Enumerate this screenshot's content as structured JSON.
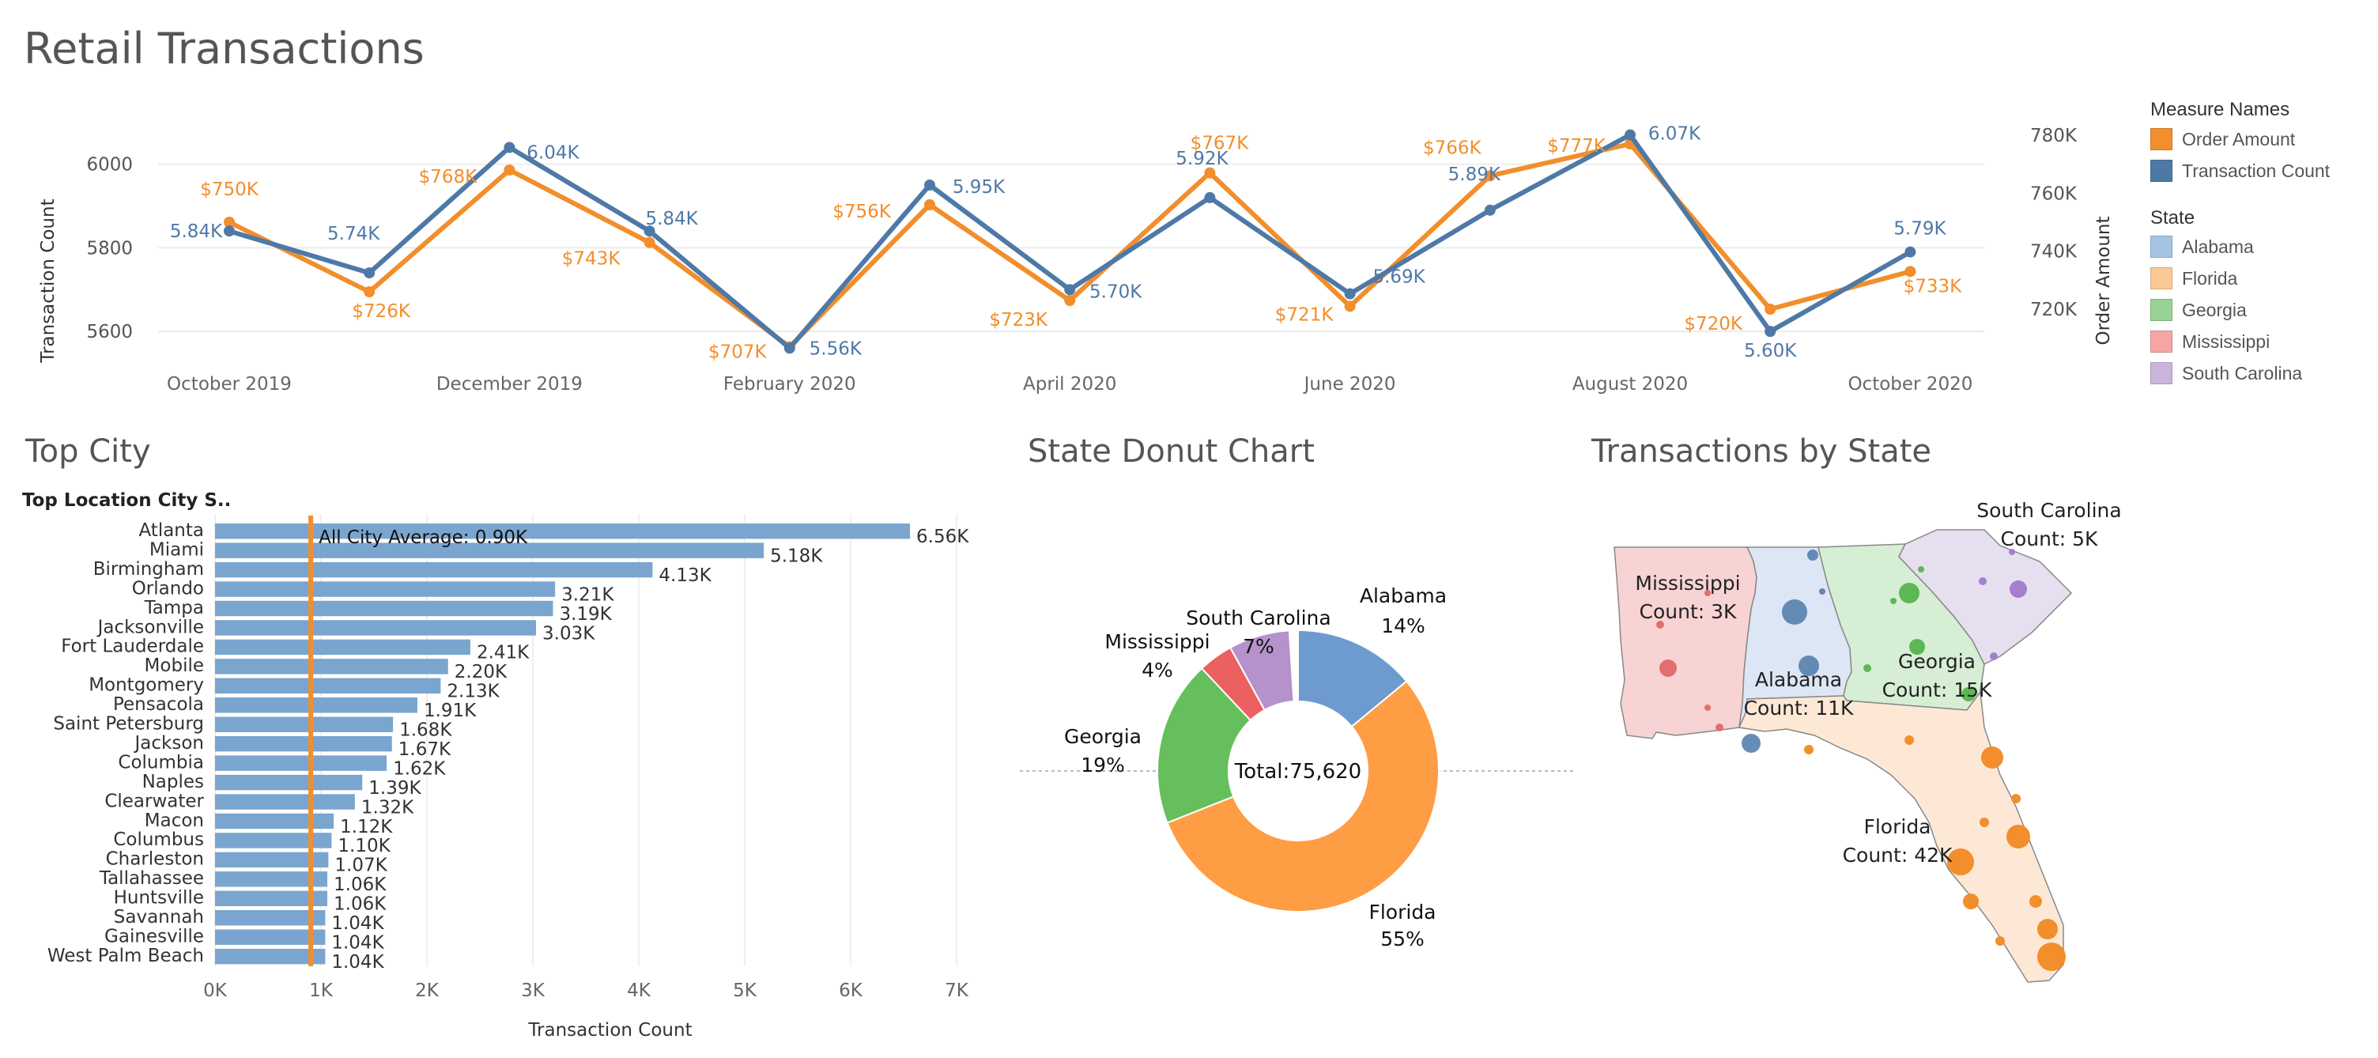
{
  "dashboard": {
    "title": "Retail Transactions",
    "sections": {
      "top_city": "Top City",
      "donut": "State Donut Chart",
      "map": "Transactions by State"
    }
  },
  "colors": {
    "orange": "#F28E2B",
    "blue": "#4E79A7",
    "bar": "#7AA5CF",
    "alabama": "#A5C3E3",
    "florida": "#FBC995",
    "georgia": "#98D294",
    "mississippi": "#F4A6A6",
    "south_carolina": "#C9B5DC"
  },
  "legend": {
    "measure_title": "Measure Names",
    "measures": [
      {
        "label": "Order Amount",
        "color": "#F28E2B"
      },
      {
        "label": "Transaction Count",
        "color": "#4E79A7"
      }
    ],
    "state_title": "State",
    "states": [
      {
        "label": "Alabama",
        "color": "#A5C3E3"
      },
      {
        "label": "Florida",
        "color": "#FBC995"
      },
      {
        "label": "Georgia",
        "color": "#98D294"
      },
      {
        "label": "Mississippi",
        "color": "#F4A6A6"
      },
      {
        "label": "South Carolina",
        "color": "#C9B5DC"
      }
    ]
  },
  "chart_data": [
    {
      "type": "line",
      "title": "",
      "x_months": [
        "Oct 2019",
        "Nov 2019",
        "Dec 2019",
        "Jan 2020",
        "Feb 2020",
        "Mar 2020",
        "Apr 2020",
        "May 2020",
        "Jun 2020",
        "Jul 2020",
        "Aug 2020",
        "Sep 2020",
        "Oct 2020"
      ],
      "x_tick_labels": [
        "October 2019",
        "December 2019",
        "February 2020",
        "April 2020",
        "June 2020",
        "August 2020",
        "October 2020"
      ],
      "ylabel_left": "Transaction Count",
      "ylabel_right": "Order Amount",
      "left_ticks": [
        "5600",
        "5800",
        "6000"
      ],
      "right_ticks": [
        "720K",
        "740K",
        "760K",
        "780K"
      ],
      "ylim_left": [
        5570,
        6090
      ],
      "ylim_right": [
        708,
        783
      ],
      "series": [
        {
          "name": "Transaction Count",
          "axis": "left",
          "color": "#4E79A7",
          "values": [
            5840,
            5740,
            6040,
            5840,
            5560,
            5950,
            5700,
            5920,
            5690,
            5890,
            6070,
            5600,
            5790
          ],
          "labels": [
            "5.84K",
            "5.74K",
            "6.04K",
            "5.84K",
            "5.56K",
            "5.95K",
            "5.70K",
            "5.92K",
            "5.69K",
            "5.89K",
            "6.07K",
            "5.60K",
            "5.79K"
          ]
        },
        {
          "name": "Order Amount",
          "axis": "right",
          "color": "#F28E2B",
          "values": [
            750,
            726,
            768,
            743,
            707,
            756,
            723,
            767,
            721,
            766,
            777,
            720,
            733
          ],
          "labels": [
            "$750K",
            "$726K",
            "$768K",
            "$743K",
            "$707K",
            "$756K",
            "$723K",
            "$767K",
            "$721K",
            "$766K",
            "$777K",
            "$720K",
            "$733K"
          ]
        }
      ]
    },
    {
      "type": "bar",
      "title": "Top City",
      "header": "Top Location City S..",
      "xlabel": "Transaction Count",
      "x_ticks": [
        "0K",
        "1K",
        "2K",
        "3K",
        "4K",
        "5K",
        "6K",
        "7K"
      ],
      "xlim": [
        0,
        7000
      ],
      "reference_line": {
        "value": 900,
        "label": "All City Average: 0.90K"
      },
      "categories": [
        "Atlanta",
        "Miami",
        "Birmingham",
        "Orlando",
        "Tampa",
        "Jacksonville",
        "Fort Lauderdale",
        "Mobile",
        "Montgomery",
        "Pensacola",
        "Saint Petersburg",
        "Jackson",
        "Columbia",
        "Naples",
        "Clearwater",
        "Macon",
        "Columbus",
        "Charleston",
        "Tallahassee",
        "Huntsville",
        "Savannah",
        "Gainesville",
        "West Palm Beach"
      ],
      "values": [
        6560,
        5180,
        4130,
        3210,
        3190,
        3030,
        2410,
        2200,
        2130,
        1910,
        1680,
        1670,
        1620,
        1390,
        1320,
        1120,
        1100,
        1070,
        1060,
        1060,
        1040,
        1040,
        1040
      ],
      "labels": [
        "6.56K",
        "5.18K",
        "4.13K",
        "3.21K",
        "3.19K",
        "3.03K",
        "2.41K",
        "2.20K",
        "2.13K",
        "1.91K",
        "1.68K",
        "1.67K",
        "1.62K",
        "1.39K",
        "1.32K",
        "1.12K",
        "1.10K",
        "1.07K",
        "1.06K",
        "1.06K",
        "1.04K",
        "1.04K",
        "1.04K"
      ]
    },
    {
      "type": "pie",
      "title": "State Donut Chart",
      "center_label": "Total:75,620",
      "slices": [
        {
          "name": "Alabama",
          "pct": 14,
          "label": "14%",
          "color": "#6E9BCF"
        },
        {
          "name": "Florida",
          "pct": 55,
          "label": "55%",
          "color": "#FF9D45"
        },
        {
          "name": "Georgia",
          "pct": 19,
          "label": "19%",
          "color": "#64BF5C"
        },
        {
          "name": "Mississippi",
          "pct": 4,
          "label": "4%",
          "color": "#EB6060"
        },
        {
          "name": "South Carolina",
          "pct": 7,
          "label": "7%",
          "color": "#B592CC"
        }
      ]
    }
  ],
  "map": {
    "title": "Transactions by State",
    "states": [
      {
        "name": "Mississippi",
        "count_label": "Count: 3K"
      },
      {
        "name": "Alabama",
        "count_label": "Count: 11K"
      },
      {
        "name": "Georgia",
        "count_label": "Count: 15K"
      },
      {
        "name": "South Carolina",
        "count_label": "Count: 5K"
      },
      {
        "name": "Florida",
        "count_label": "Count: 42K"
      }
    ]
  }
}
